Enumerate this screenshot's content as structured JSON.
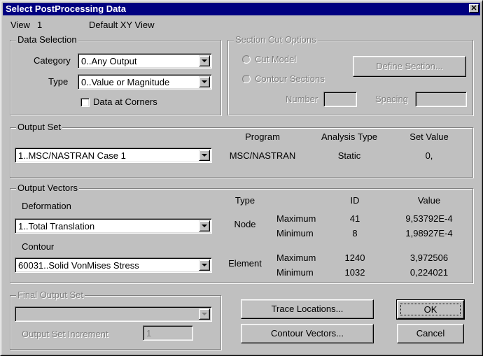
{
  "window": {
    "title": "Select PostProcessing Data",
    "close_glyph": "✕"
  },
  "header": {
    "view_label": "View",
    "view_number": "1",
    "view_name": "Default XY View"
  },
  "data_selection": {
    "label": "Data Selection",
    "category_label": "Category",
    "category_value": "0..Any Output",
    "type_label": "Type",
    "type_value": "0..Value or Magnitude",
    "corners_label": "Data at Corners",
    "corners_checked": false
  },
  "section_cut": {
    "label": "Section Cut Options",
    "cut_model": "Cut Model",
    "contour_sections": "Contour Sections",
    "define_section": "Define Section...",
    "number_label": "Number",
    "spacing_label": "Spacing"
  },
  "output_set": {
    "label": "Output Set",
    "value": "1..MSC/NASTRAN Case 1",
    "col_program": "Program",
    "col_analysis": "Analysis Type",
    "col_setvalue": "Set Value",
    "program": "MSC/NASTRAN",
    "analysis": "Static",
    "setvalue": "0,"
  },
  "output_vectors": {
    "label": "Output Vectors",
    "deformation_label": "Deformation",
    "deformation_value": "1..Total Translation",
    "contour_label": "Contour",
    "contour_value": "60031..Solid VonMises Stress",
    "col_type": "Type",
    "col_id": "ID",
    "col_value": "Value",
    "rows": [
      {
        "type": "Node",
        "kind": "Maximum",
        "id": "41",
        "value": "9,53792E-4"
      },
      {
        "type": "",
        "kind": "Minimum",
        "id": "8",
        "value": "1,98927E-4"
      },
      {
        "type": "Element",
        "kind": "Maximum",
        "id": "1240",
        "value": "3,972506"
      },
      {
        "type": "",
        "kind": "Minimum",
        "id": "1032",
        "value": "0,224021"
      }
    ]
  },
  "final_output": {
    "label": "Final Output Set",
    "increment_label": "Output Set Increment",
    "increment_value": "1"
  },
  "buttons": {
    "trace": "Trace Locations...",
    "contour_vectors": "Contour Vectors...",
    "ok": "OK",
    "cancel": "Cancel"
  }
}
